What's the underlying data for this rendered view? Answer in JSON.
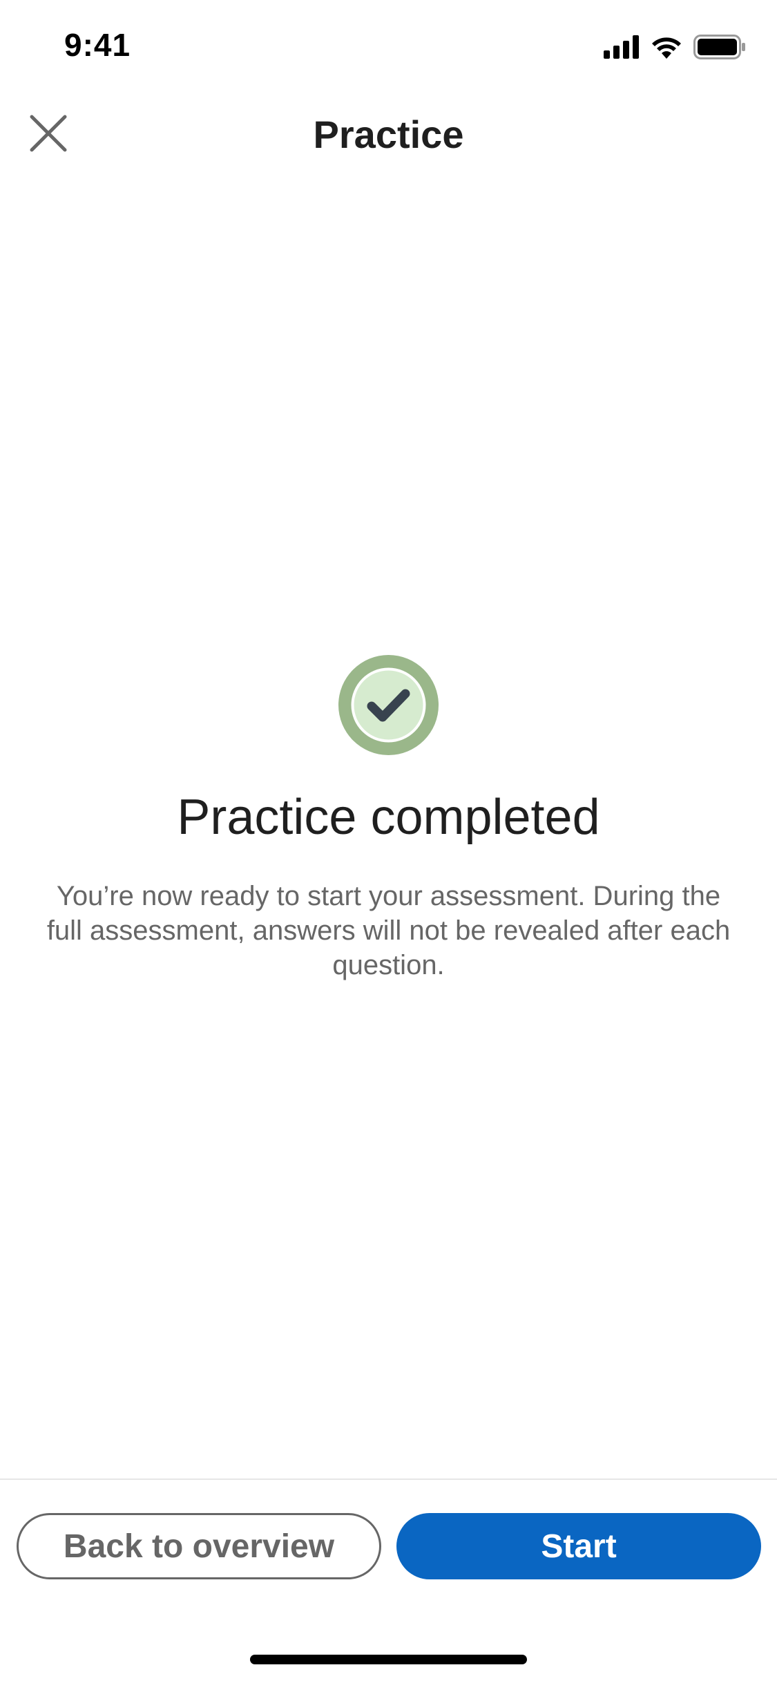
{
  "status_bar": {
    "time": "9:41",
    "icons": [
      "cellular-signal-icon",
      "wifi-icon",
      "battery-icon"
    ]
  },
  "header": {
    "title": "Practice",
    "close_icon": "close-icon"
  },
  "main": {
    "badge_icon": "checkmark-icon",
    "title": "Practice completed",
    "message": "You’re now ready to start your assessment. During the full assessment, answers will not be revealed after each question."
  },
  "footer": {
    "back_label": "Back to overview",
    "start_label": "Start"
  },
  "colors": {
    "primary": "#0a66c2",
    "success_ring": "#9ab78a",
    "success_fill": "#d6ebcf",
    "check": "#38434f"
  }
}
